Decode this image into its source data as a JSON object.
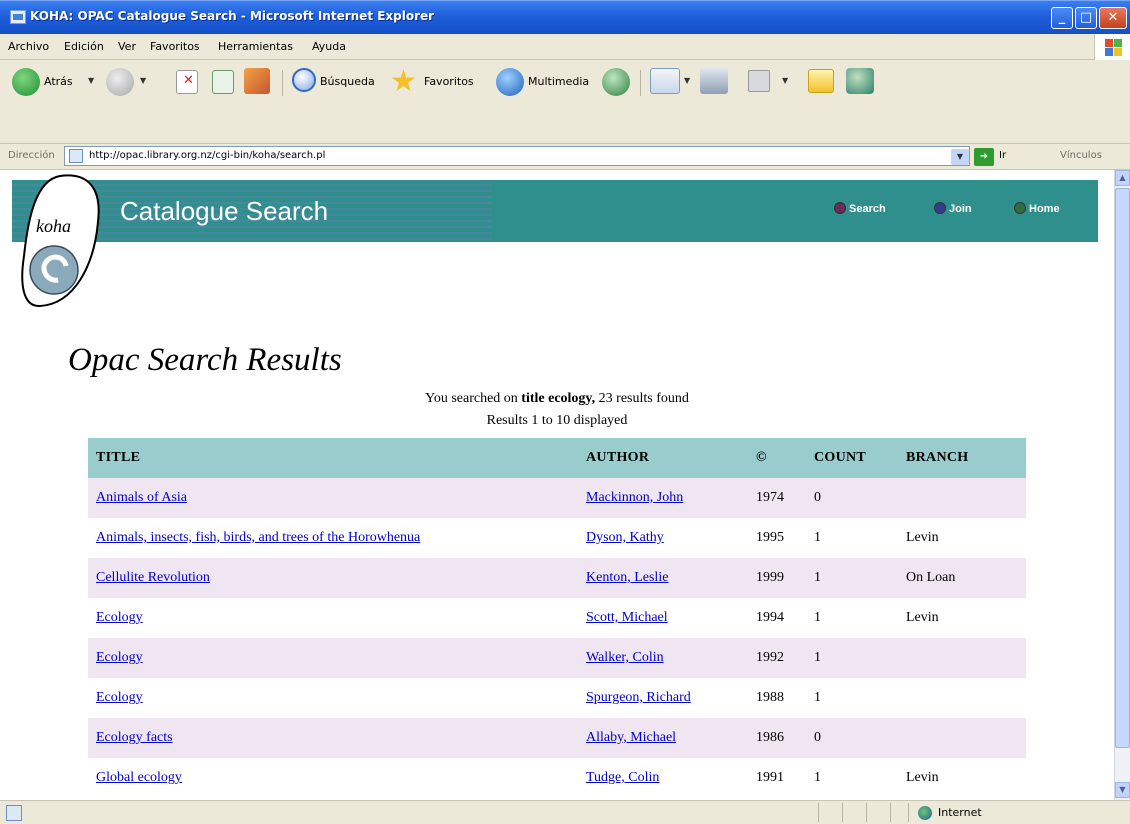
{
  "window": {
    "title": "KOHA: OPAC Catalogue Search - Microsoft Internet Explorer"
  },
  "menu": {
    "items": [
      "Archivo",
      "Edición",
      "Ver",
      "Favoritos",
      "Herramientas",
      "Ayuda"
    ]
  },
  "toolbar": {
    "back_label": "Atrás",
    "search_label": "Búsqueda",
    "favorites_label": "Favoritos",
    "media_label": "Multimedia"
  },
  "address": {
    "label": "Dirección",
    "url": "http://opac.library.org.nz/cgi-bin/koha/search.pl",
    "go_label": "Ir",
    "links_label": "Vínculos"
  },
  "header": {
    "logo_text": "koha",
    "title": "Catalogue Search",
    "nav": [
      {
        "label": "Search",
        "color": "#6b2a5a"
      },
      {
        "label": "Join",
        "color": "#2f3f8f"
      },
      {
        "label": "Home",
        "color": "#2f6f3f"
      }
    ]
  },
  "results": {
    "heading": "Opac Search Results",
    "summary_prefix": "You searched on",
    "summary_query": "title ecology,",
    "summary_suffix": "23 results found",
    "range_text": "Results 1 to 10 displayed",
    "columns": [
      "TITLE",
      "AUTHOR",
      "©",
      "COUNT",
      "BRANCH"
    ],
    "rows": [
      {
        "title": "Animals of Asia",
        "author": "Mackinnon, John",
        "year": "1974",
        "count": "0",
        "branch": ""
      },
      {
        "title": "Animals, insects, fish, birds, and trees of the Horowhenua",
        "author": "Dyson, Kathy",
        "year": "1995",
        "count": "1",
        "branch": "Levin"
      },
      {
        "title": "Cellulite Revolution",
        "author": "Kenton, Leslie",
        "year": "1999",
        "count": "1",
        "branch": "On Loan"
      },
      {
        "title": "Ecology",
        "author": "Scott, Michael",
        "year": "1994",
        "count": "1",
        "branch": "Levin"
      },
      {
        "title": "Ecology",
        "author": "Walker, Colin",
        "year": "1992",
        "count": "1",
        "branch": ""
      },
      {
        "title": "Ecology",
        "author": "Spurgeon, Richard",
        "year": "1988",
        "count": "1",
        "branch": ""
      },
      {
        "title": "Ecology facts",
        "author": "Allaby, Michael",
        "year": "1986",
        "count": "0",
        "branch": ""
      },
      {
        "title": "Global ecology",
        "author": "Tudge, Colin",
        "year": "1991",
        "count": "1",
        "branch": "Levin"
      }
    ]
  },
  "status": {
    "zone": "Internet"
  }
}
